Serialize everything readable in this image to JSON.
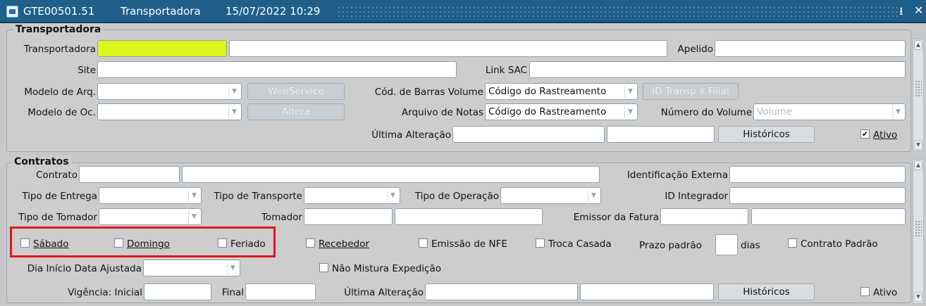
{
  "titlebar": {
    "code": "GTE00501.51",
    "name": "Transportadora",
    "datetime": "15/07/2022 10:29",
    "minimize": "⭳",
    "close": "✕"
  },
  "transportadora_frame": {
    "title": "Transportadora",
    "transportadora_label": "Transportadora",
    "apelido_label": "Apelido",
    "site_label": "Site",
    "link_sac_label": "Link SAC",
    "modelo_arq_label": "Modelo de Arq.",
    "webservice_label": "WebService",
    "cod_barras_label": "Cód. de Barras Volume",
    "cod_barras_value": "Código do Rastreamento",
    "id_transp_label": "ID Transp x Filial",
    "modelo_oc_label": "Modelo de Oc.",
    "altera_label": "Altera",
    "arquivo_notas_label": "Arquivo de Notas",
    "arquivo_notas_value": "Código do Rastreamento",
    "numero_volume_label": "Número do Volume",
    "numero_volume_value": "Volume",
    "ultima_alteracao_label": "Última Alteração",
    "historicos_label": "Históricos",
    "ativo_label": "Ativo",
    "ativo_checked": "✔"
  },
  "contratos_frame": {
    "title": "Contratos",
    "contrato_label": "Contrato",
    "identificacao_externa_label": "Identificação Externa",
    "tipo_entrega_label": "Tipo de Entrega",
    "tipo_transporte_label": "Tipo de Transporte",
    "tipo_operacao_label": "Tipo de Operação",
    "id_integrador_label": "ID Integrador",
    "tipo_tomador_label": "Tipo de Tomador",
    "tomador_label": "Tomador",
    "emissor_fatura_label": "Emissor da Fatura",
    "sabado_label": "Sábado",
    "domingo_label": "Domingo",
    "feriado_label": "Feriado",
    "recebedor_label": "Recebedor",
    "emissao_nfe_label": "Emissão de NFE",
    "troca_casada_label": "Troca Casada",
    "prazo_padrao_label": "Prazo padrão",
    "dias_label": "dias",
    "contrato_padrao_label": "Contrato Padrão",
    "dia_inicio_label": "Dia Início Data Ajustada",
    "nao_mistura_label": "Não Mistura Expedição",
    "vigencia_inicial_label": "Vigência: Inicial",
    "final_label": "Final",
    "ultima_alteracao_label": "Última Alteração",
    "historicos_label": "Históricos",
    "ativo_label": "Ativo"
  },
  "colors": {
    "titlebar": "#1f5f8a",
    "required_field": "#ddf51a",
    "highlight": "#e0141e"
  },
  "icons": {
    "app": "app-form-icon",
    "dropdown": "chevron-down-icon",
    "check": "checkmark-icon"
  }
}
